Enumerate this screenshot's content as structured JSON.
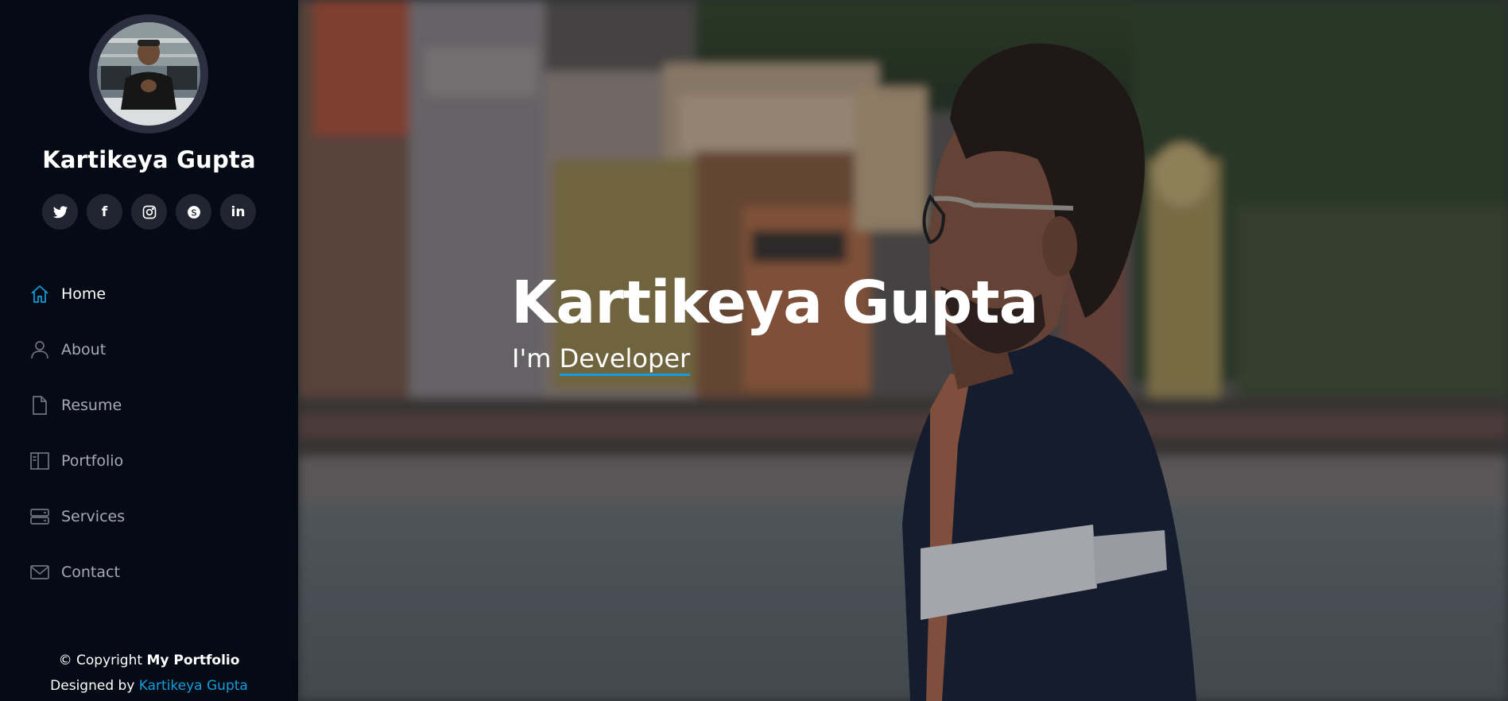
{
  "sidebar": {
    "profile_name": "Kartikeya Gupta",
    "avatar_alt": "profile-photo",
    "social": [
      {
        "name": "twitter-icon",
        "label": ""
      },
      {
        "name": "facebook-icon",
        "label": "f"
      },
      {
        "name": "instagram-icon",
        "label": ""
      },
      {
        "name": "skype-icon",
        "label": ""
      },
      {
        "name": "linkedin-icon",
        "label": "in"
      }
    ],
    "nav": [
      {
        "label": "Home",
        "icon": "home-icon",
        "active": true
      },
      {
        "label": "About",
        "icon": "person-icon",
        "active": false
      },
      {
        "label": "Resume",
        "icon": "file-icon",
        "active": false
      },
      {
        "label": "Portfolio",
        "icon": "book-icon",
        "active": false
      },
      {
        "label": "Services",
        "icon": "server-icon",
        "active": false
      },
      {
        "label": "Contact",
        "icon": "envelope-icon",
        "active": false
      }
    ],
    "footer": {
      "copyright_prefix": "© Copyright",
      "copyright_brand": "My Portfolio",
      "designed_prefix": "Designed by",
      "designed_by": "Kartikeya Gupta"
    }
  },
  "hero": {
    "title": "Kartikeya Gupta",
    "subtitle_prefix": "I'm",
    "subtitle_typed": "Developer"
  },
  "colors": {
    "sidebar_bg": "#040b14",
    "accent": "#149ddd",
    "social_bg": "#212431",
    "nav_text": "#a8a9b4"
  }
}
